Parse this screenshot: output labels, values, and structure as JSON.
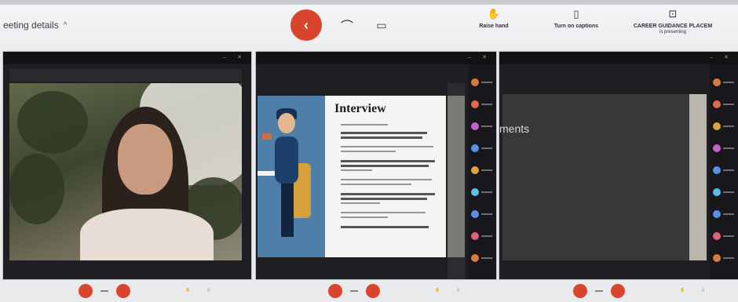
{
  "meeting": {
    "details_label": "eeting details",
    "details_chevron": "^"
  },
  "controls": {
    "leave_icon": "phone-hangup-icon",
    "leave_glyph": "‹",
    "mic_glyph": "⌒",
    "camera_glyph": "▭",
    "raise_hand_label": "Raise hand",
    "raise_hand_icon": "hand-icon",
    "captions_label": "Turn on captions",
    "captions_icon": "captions-icon",
    "present_label": "CAREER GUIDANCE PLACEM",
    "present_sub": "is presenting",
    "present_icon": "present-icon"
  },
  "screens": [
    {
      "id": "camera-view",
      "type": "camera"
    },
    {
      "id": "slide-view",
      "slide_title": "Interview"
    },
    {
      "id": "shared-view",
      "overlay_text": "ments"
    }
  ],
  "colors": {
    "leave_red": "#d9442f",
    "background": "#e9eaec",
    "screen_dark": "#1f1e22"
  }
}
